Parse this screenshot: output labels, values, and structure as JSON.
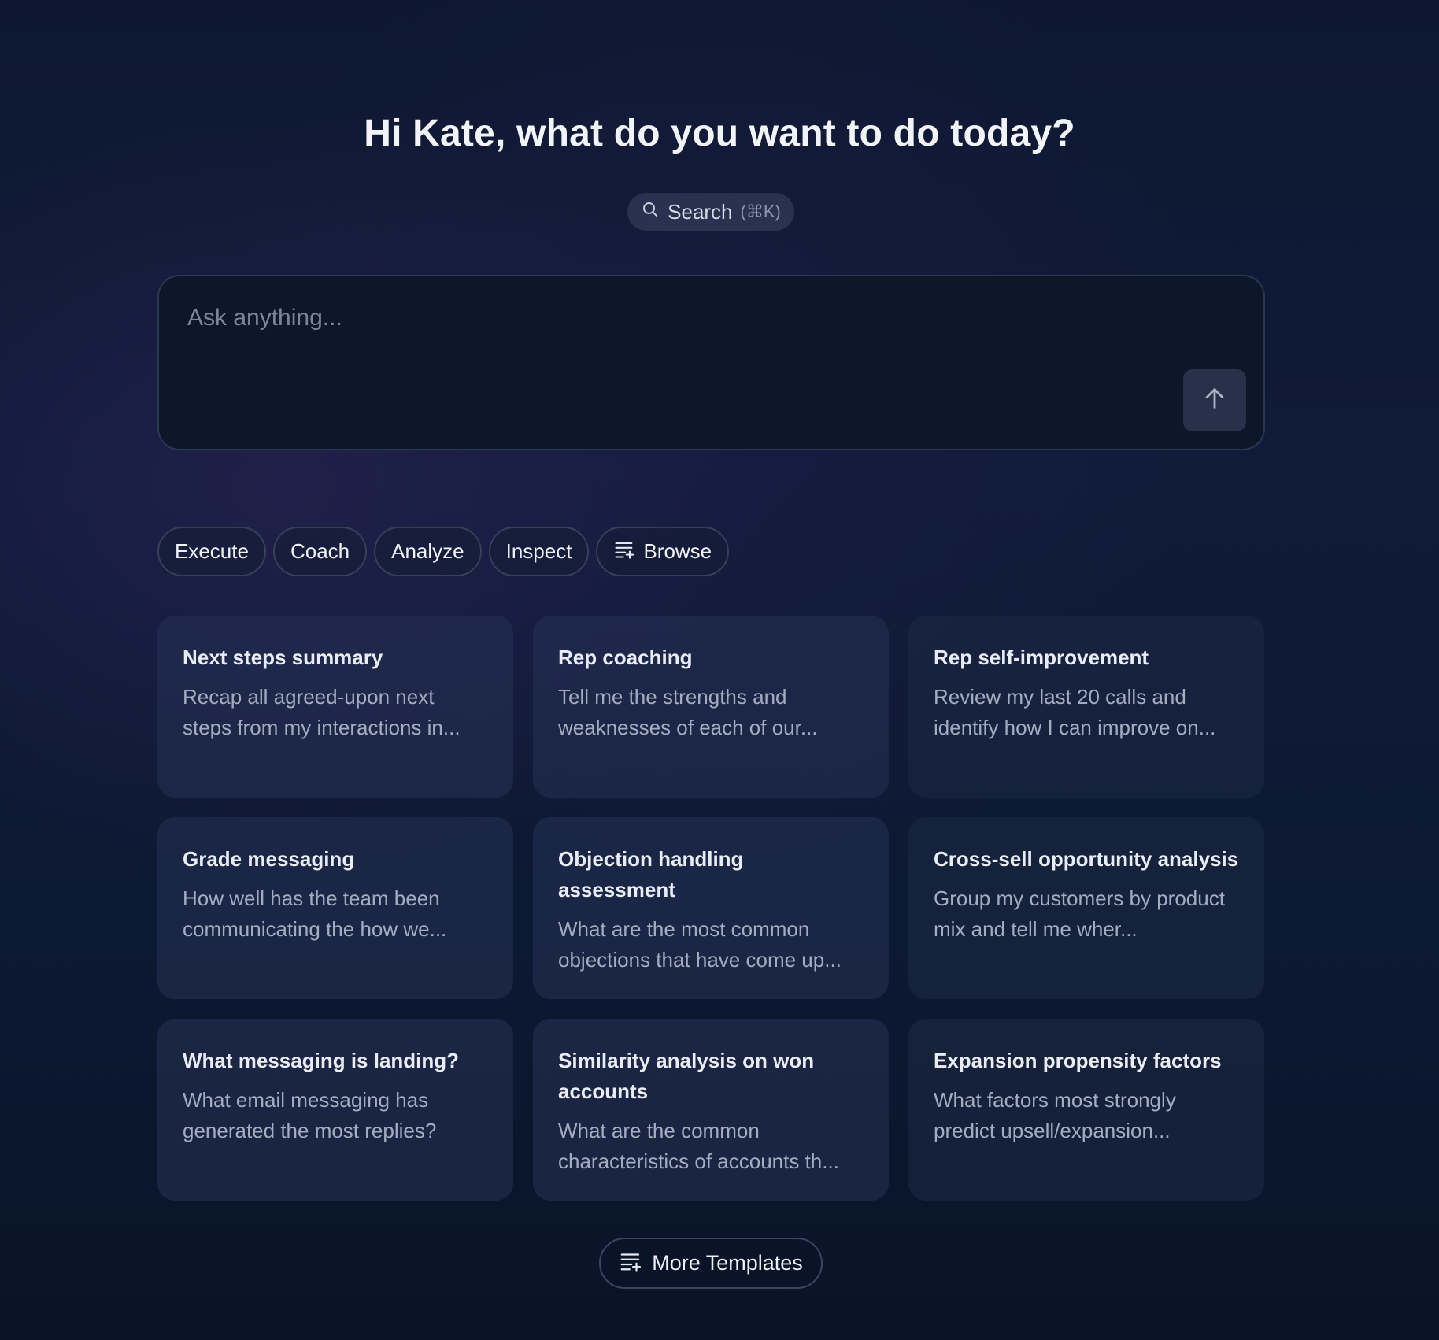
{
  "greeting": "Hi Kate, what do you want to do today?",
  "search": {
    "label": "Search",
    "shortcut": "(⌘K)",
    "icon": "search-icon"
  },
  "ask": {
    "placeholder": "Ask anything...",
    "send_icon": "arrow-up-icon"
  },
  "chips": [
    {
      "label": "Execute"
    },
    {
      "label": "Coach"
    },
    {
      "label": "Analyze"
    },
    {
      "label": "Inspect"
    },
    {
      "label": "Browse",
      "icon": "list-icon"
    }
  ],
  "cards": [
    {
      "title": "Next steps summary",
      "desc": "Recap all agreed-upon next steps from my interactions in..."
    },
    {
      "title": "Rep coaching",
      "desc": "Tell me the strengths and weaknesses of each of our..."
    },
    {
      "title": "Rep self-improvement",
      "desc": "Review my last 20 calls and identify how I can improve on..."
    },
    {
      "title": "Grade messaging",
      "desc": "How well has the team been communicating the how we..."
    },
    {
      "title": "Objection handling assessment",
      "desc": "What are the most common objections that have come up..."
    },
    {
      "title": "Cross-sell opportunity analysis",
      "desc": "Group my customers by product mix and tell me wher..."
    },
    {
      "title": "What messaging is landing?",
      "desc": "What email messaging has generated the most replies?"
    },
    {
      "title": "Similarity analysis on won accounts",
      "desc": "What are the common characteristics of accounts th..."
    },
    {
      "title": "Expansion propensity factors",
      "desc": "What factors most strongly predict upsell/expansion..."
    }
  ],
  "more_templates": {
    "label": "More Templates",
    "icon": "list-icon"
  },
  "colors": {
    "background": "#0d1830",
    "card": "#1f2a4a",
    "chip_border": "#354158",
    "send_button": "#27324a"
  }
}
